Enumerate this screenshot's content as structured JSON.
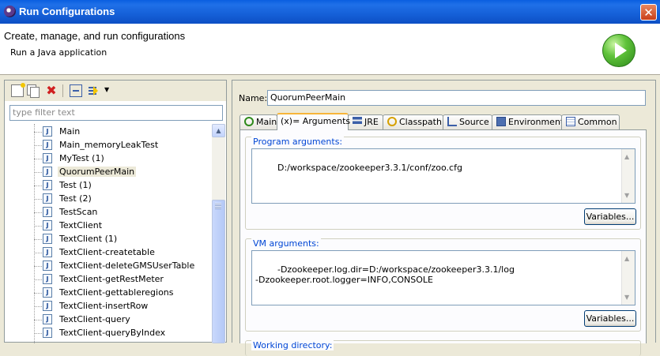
{
  "window": {
    "title": "Run Configurations",
    "close_label": "✕"
  },
  "header": {
    "title": "Create, manage, and run configurations",
    "subtitle": "Run a Java application"
  },
  "left": {
    "filter_placeholder": "type filter text",
    "items": [
      {
        "label": "Main",
        "selected": false
      },
      {
        "label": "Main_memoryLeakTest",
        "selected": false
      },
      {
        "label": "MyTest (1)",
        "selected": false
      },
      {
        "label": "QuorumPeerMain",
        "selected": true
      },
      {
        "label": "Test (1)",
        "selected": false
      },
      {
        "label": "Test (2)",
        "selected": false
      },
      {
        "label": "TestScan",
        "selected": false
      },
      {
        "label": "TextClient",
        "selected": false
      },
      {
        "label": "TextClient (1)",
        "selected": false
      },
      {
        "label": "TextClient-createtable",
        "selected": false
      },
      {
        "label": "TextClient-deleteGMSUserTable",
        "selected": false
      },
      {
        "label": "TextClient-getRestMeter",
        "selected": false
      },
      {
        "label": "TextClient-gettableregions",
        "selected": false
      },
      {
        "label": "TextClient-insertRow",
        "selected": false
      },
      {
        "label": "TextClient-query",
        "selected": false
      },
      {
        "label": "TextClient-queryByIndex",
        "selected": false
      }
    ]
  },
  "right": {
    "name_label": "Name:",
    "name_value": "QuorumPeerMain",
    "tabs": [
      {
        "label": "Main"
      },
      {
        "label": "(x)= Arguments"
      },
      {
        "label": "JRE"
      },
      {
        "label": "Classpath"
      },
      {
        "label": "Source"
      },
      {
        "label": "Environment"
      },
      {
        "label": "Common"
      }
    ],
    "program_args_label": "Program arguments:",
    "program_args_value": "D:/workspace/zookeeper3.3.1/conf/zoo.cfg",
    "vm_args_label": "VM arguments:",
    "vm_args_value": "-Dzookeeper.log.dir=D:/workspace/zookeeper3.3.1/log\n-Dzookeeper.root.logger=INFO,CONSOLE",
    "variables_label": "Variables...",
    "working_dir_label": "Working directory:"
  }
}
